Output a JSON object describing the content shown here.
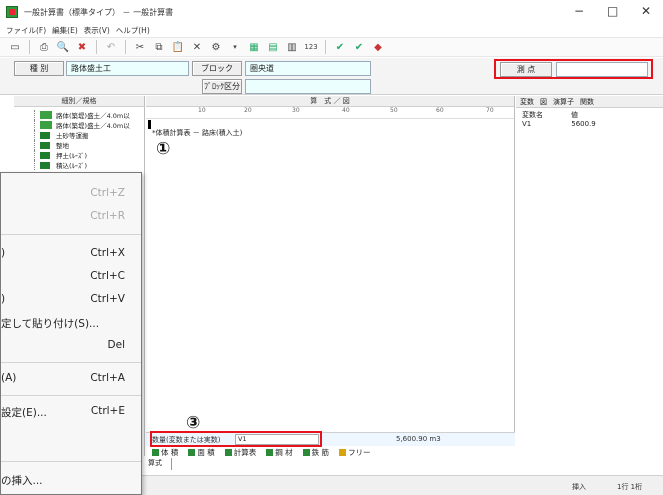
{
  "window": {
    "title": "一般計算書（標準タイプ） － 一般計算書",
    "controls": {
      "minimize": "−",
      "maximize": "□",
      "close": "✕"
    }
  },
  "menu": [
    "ファイル(F)",
    "編集(E)",
    "表示(V)",
    "ヘルプ(H)"
  ],
  "toolbar": {
    "icons": [
      "save-icon",
      "print-icon",
      "preview-icon",
      "delete-icon",
      "undo-icon",
      "cut-icon",
      "copy-icon",
      "paste-icon",
      "close-x-icon",
      "tool-icon",
      "grid1-icon",
      "grid2-icon",
      "grid3-icon",
      "numbers-icon",
      "check1-icon",
      "check2-icon",
      "diamond-icon"
    ],
    "numbers_label": "123"
  },
  "info": {
    "category_label": "種 別",
    "category_value": "路体盛土工",
    "block_label": "ブロック",
    "block_value": "圏央道",
    "block_division_label": "ﾌﾞﾛｯｸ区分",
    "block_division_value": "",
    "measure_label": "測 点",
    "measure_value": ""
  },
  "left_panel": {
    "header": "細別／規格",
    "items": [
      "路体(築堤)盛土／4.0m以",
      "路体(築堤)盛土／4.0m以",
      "土砂等運搬",
      "整地",
      "押土(ﾙｰｽﾞ)",
      "積込(ﾙｰｽﾞ)"
    ]
  },
  "editor": {
    "header": "算　式 ／ 図",
    "ruler_labels": [
      "10",
      "20",
      "30",
      "40",
      "50",
      "60",
      "70"
    ],
    "first_line": "*体積計算表 － 路床(積入土)"
  },
  "right_panel": {
    "tabs": [
      "変数",
      "図",
      "演算子",
      "関数"
    ],
    "col_name": "変数名",
    "col_value": "値",
    "rows": [
      {
        "name": "V1",
        "value": "5600.9"
      }
    ]
  },
  "context_menu": [
    {
      "label": "",
      "shortcut": "Ctrl+Z",
      "disabled": true
    },
    {
      "label": "",
      "shortcut": "Ctrl+R",
      "disabled": true
    },
    {
      "label": ")",
      "shortcut": "Ctrl+X",
      "disabled": false
    },
    {
      "label": "",
      "shortcut": "Ctrl+C",
      "disabled": false
    },
    {
      "label": ")",
      "shortcut": "Ctrl+V",
      "disabled": false
    },
    {
      "label": "定して貼り付け(S)...",
      "shortcut": "",
      "disabled": false
    },
    {
      "label": "",
      "shortcut": "Del",
      "disabled": false
    },
    {
      "label": "(A)",
      "shortcut": "Ctrl+A",
      "disabled": false
    },
    {
      "label": "設定(E)...",
      "shortcut": "Ctrl+E",
      "disabled": false
    },
    {
      "label": "の挿入...",
      "shortcut": "",
      "disabled": false
    }
  ],
  "quantity": {
    "label": "数量(変数または実数)",
    "input": "V1",
    "value": "5,600.90 m3"
  },
  "tabs": [
    "体 積",
    "面 積",
    "計算表",
    "鋼 材",
    "鉄 筋",
    "フリー"
  ],
  "sheet_tab": "算式",
  "status": {
    "mode": "挿入",
    "position": "1行 1桁"
  },
  "annotations": {
    "one": "①",
    "three": "③",
    "highlight_color": "#e8121c"
  }
}
